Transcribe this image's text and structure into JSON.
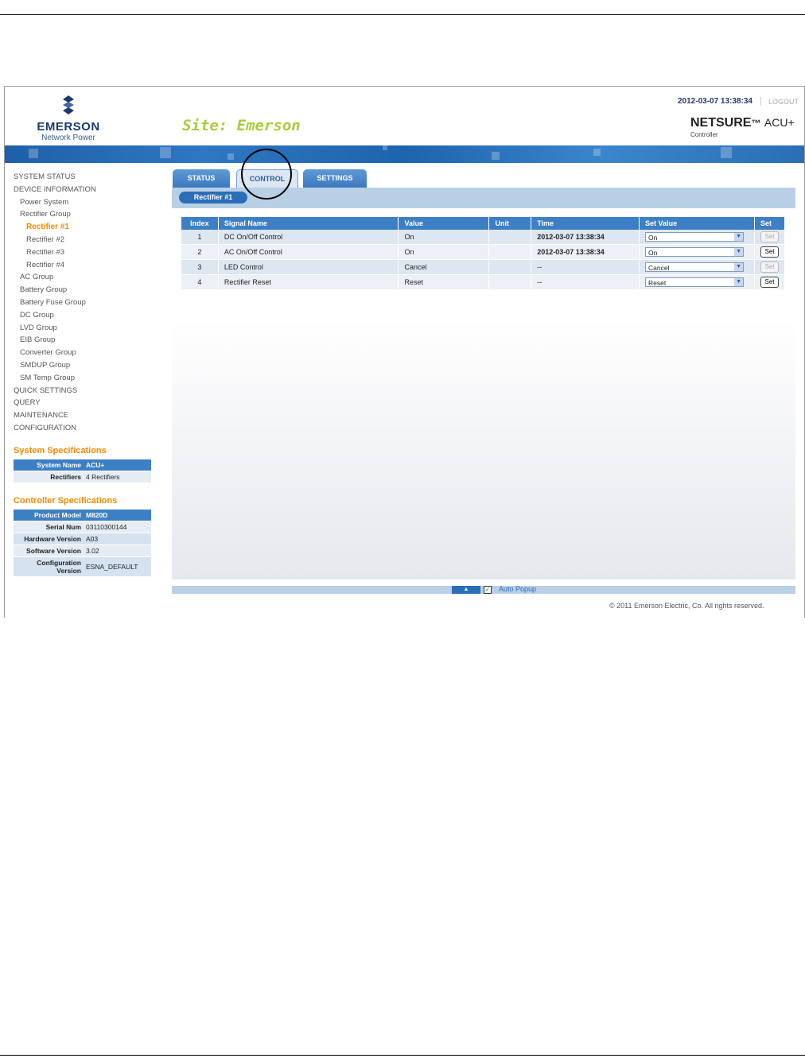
{
  "header": {
    "logo_name": "EMERSON",
    "logo_sub": "Network Power",
    "site_title": "Site: Emerson",
    "datetime": "2012-03-07 13:38:34",
    "logout": "LOGOUT",
    "brand_net": "NETSURE",
    "brand_tm": "™",
    "brand_acu": "ACU+",
    "brand_sub": "Controller"
  },
  "sidebar": {
    "items": [
      {
        "label": "SYSTEM STATUS",
        "level": 0
      },
      {
        "label": "DEVICE INFORMATION",
        "level": 0
      },
      {
        "label": "Power System",
        "level": 1
      },
      {
        "label": "Rectifier Group",
        "level": 1
      },
      {
        "label": "Rectifier #1",
        "level": 2,
        "active": true
      },
      {
        "label": "Rectifier #2",
        "level": 2
      },
      {
        "label": "Rectifier #3",
        "level": 2
      },
      {
        "label": "Rectifier #4",
        "level": 2
      },
      {
        "label": "AC Group",
        "level": 1
      },
      {
        "label": "Battery Group",
        "level": 1
      },
      {
        "label": "Battery Fuse Group",
        "level": 1
      },
      {
        "label": "DC Group",
        "level": 1
      },
      {
        "label": "LVD Group",
        "level": 1
      },
      {
        "label": "EIB Group",
        "level": 1
      },
      {
        "label": "Converter Group",
        "level": 1
      },
      {
        "label": "SMDUP Group",
        "level": 1
      },
      {
        "label": "SM Temp Group",
        "level": 1
      },
      {
        "label": "QUICK SETTINGS",
        "level": 0
      },
      {
        "label": "QUERY",
        "level": 0
      },
      {
        "label": "MAINTENANCE",
        "level": 0
      },
      {
        "label": "CONFIGURATION",
        "level": 0
      }
    ]
  },
  "system_specs": {
    "title": "System Specifications",
    "rows": [
      {
        "key": "System Name",
        "value": "ACU+"
      },
      {
        "key": "Rectifiers",
        "value": "4 Rectifiers"
      }
    ]
  },
  "controller_specs": {
    "title": "Controller Specifications",
    "rows": [
      {
        "key": "Product Model",
        "value": "M820D"
      },
      {
        "key": "Serial Num",
        "value": "03110300144"
      },
      {
        "key": "Hardware Version",
        "value": "A03"
      },
      {
        "key": "Software Version",
        "value": "3.02"
      },
      {
        "key": "Configuration Version",
        "value": "ESNA_DEFAULT"
      }
    ]
  },
  "tabs": [
    {
      "label": "STATUS"
    },
    {
      "label": "CONTROL",
      "active": true
    },
    {
      "label": "SETTINGS"
    }
  ],
  "subnav": {
    "pill": "Rectifier #1"
  },
  "control_table": {
    "headers": [
      "Index",
      "Signal Name",
      "Value",
      "Unit",
      "Time",
      "Set Value",
      "Set"
    ],
    "rows": [
      {
        "index": "1",
        "signal": "DC On/Off Control",
        "value": "On",
        "unit": "",
        "time": "2012-03-07 13:38:34",
        "set_value": "On",
        "set_label": "Set",
        "set_enabled": false
      },
      {
        "index": "2",
        "signal": "AC On/Off Control",
        "value": "On",
        "unit": "",
        "time": "2012-03-07 13:38:34",
        "set_value": "On",
        "set_label": "Set",
        "set_enabled": true
      },
      {
        "index": "3",
        "signal": "LED Control",
        "value": "Cancel",
        "unit": "",
        "time": "--",
        "set_value": "Cancel",
        "set_label": "Set",
        "set_enabled": false
      },
      {
        "index": "4",
        "signal": "Rectifier Reset",
        "value": "Reset",
        "unit": "",
        "time": "--",
        "set_value": "Reset",
        "set_label": "Set",
        "set_enabled": true
      }
    ]
  },
  "footer": {
    "auto_popup": "Auto Popup",
    "auto_popup_checked": true,
    "copyright": "© 2011 Emerson Electric, Co. All rights reserved."
  }
}
